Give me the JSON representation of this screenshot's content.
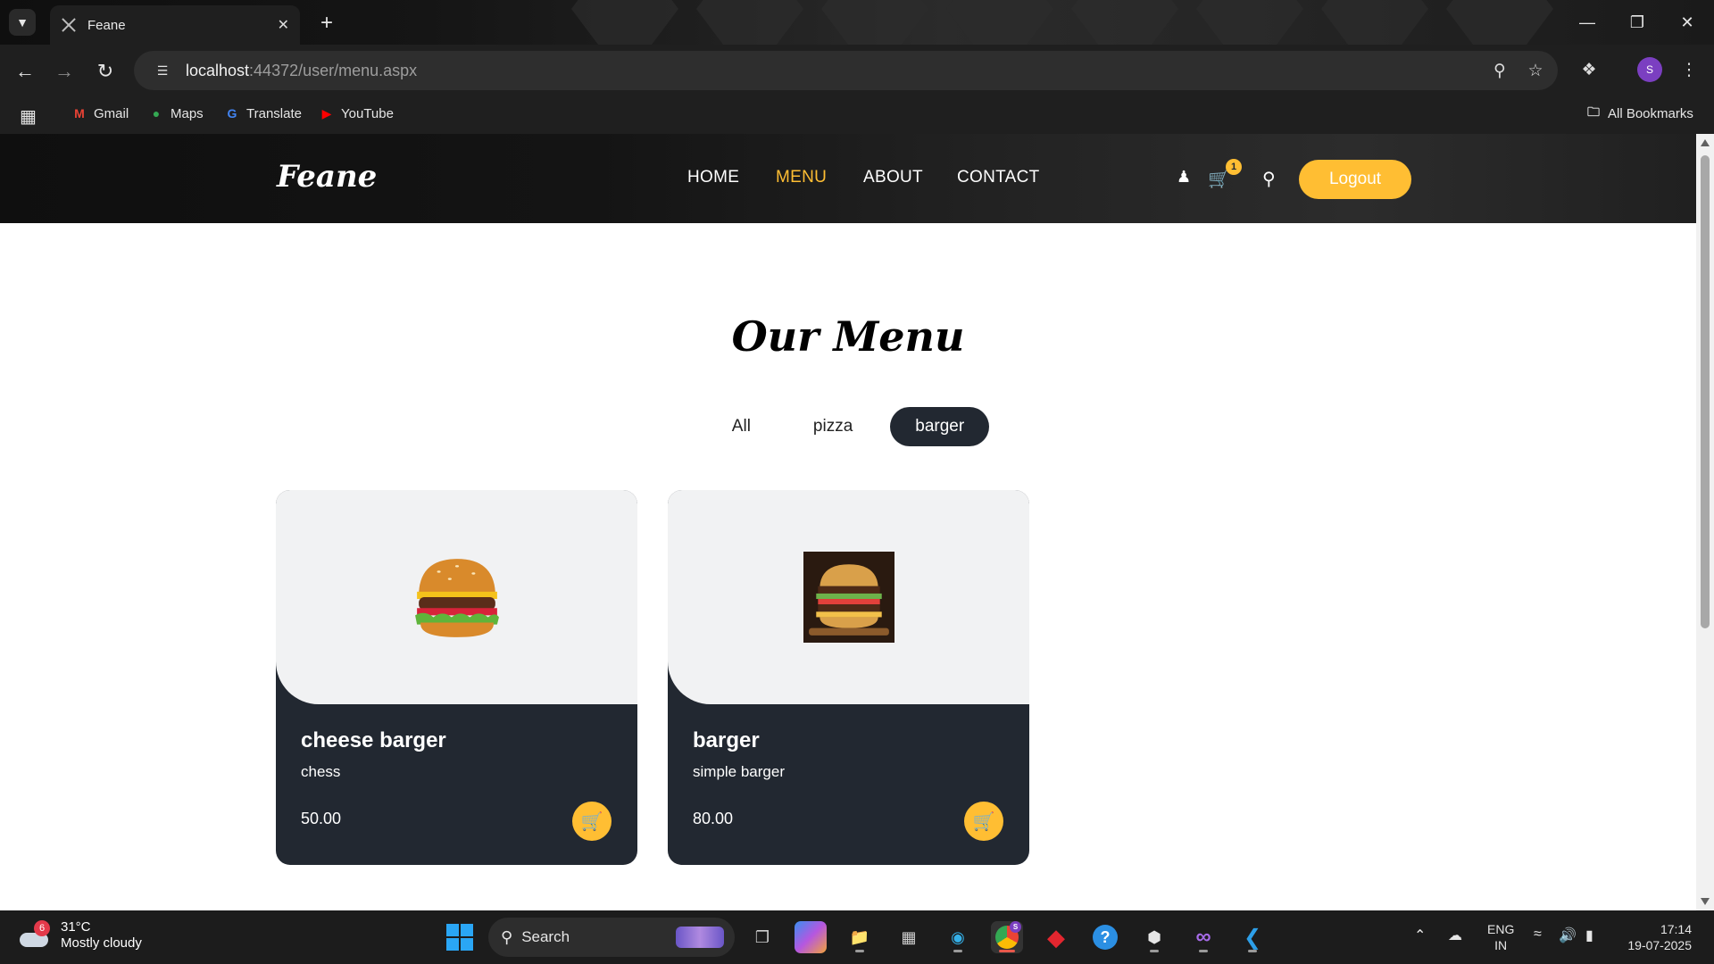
{
  "browser": {
    "tab_title": "Feane",
    "url_host": "localhost",
    "url_rest": ":44372/user/menu.aspx",
    "profile_initial": "S",
    "bookmarks": [
      {
        "label": "Gmail",
        "icon": "gmail-icon",
        "color": "#ea4335"
      },
      {
        "label": "Maps",
        "icon": "maps-icon",
        "color": "#34a853"
      },
      {
        "label": "Translate",
        "icon": "translate-icon",
        "color": "#4285f4"
      },
      {
        "label": "YouTube",
        "icon": "youtube-icon",
        "color": "#ff0000"
      }
    ],
    "all_bookmarks": "All Bookmarks"
  },
  "site": {
    "brand": "Feane",
    "nav": [
      "HOME",
      "MENU",
      "ABOUT",
      "CONTACT"
    ],
    "active_nav": "MENU",
    "cart_count": "1",
    "logout_label": "Logout",
    "accent_color": "#ffbe33",
    "dark_color": "#222831"
  },
  "menu": {
    "title": "Our Menu",
    "filters": [
      "All",
      "pizza",
      "barger"
    ],
    "active_filter": "barger",
    "items": [
      {
        "name": "cheese barger",
        "desc": "chess",
        "price": "50.00"
      },
      {
        "name": "barger",
        "desc": "simple barger",
        "price": "80.00"
      }
    ]
  },
  "taskbar": {
    "weather_badge": "6",
    "temperature": "31°C",
    "condition": "Mostly cloudy",
    "search_label": "Search",
    "lang_top": "ENG",
    "lang_bottom": "IN",
    "time": "17:14",
    "date": "19-07-2025",
    "chrome_badge": "S"
  }
}
